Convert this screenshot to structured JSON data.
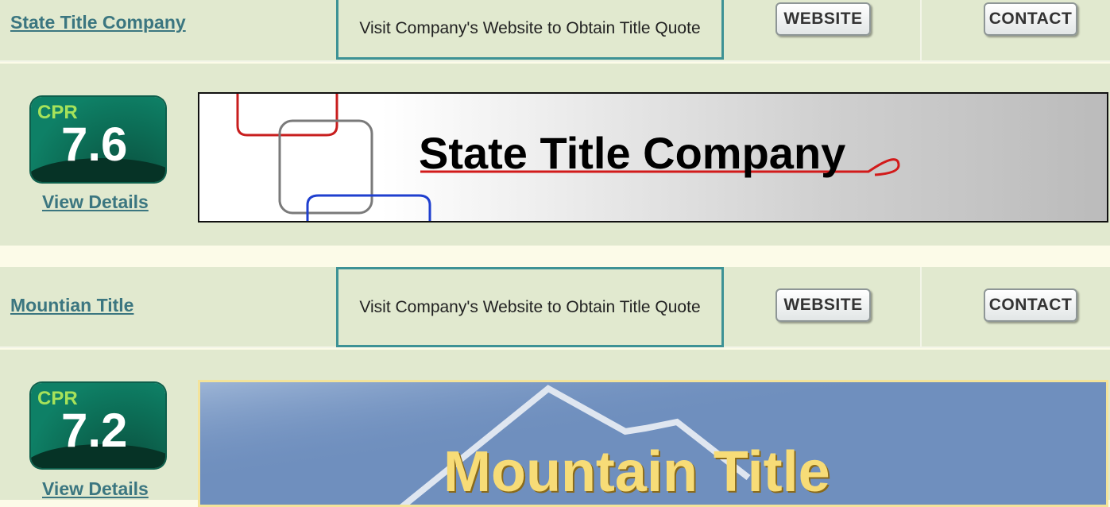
{
  "listings": [
    {
      "company_name": "State Title Company",
      "quote_text": "Visit Company's Website to Obtain Title Quote",
      "website_label": "WEBSITE",
      "contact_label": "CONTACT",
      "cpr_label": "CPR",
      "cpr_score": "7.6",
      "view_details": "View Details",
      "banner_text": "State Title Company"
    },
    {
      "company_name": "Mountian Title",
      "quote_text": "Visit Company's Website to Obtain Title Quote",
      "website_label": "WEBSITE",
      "contact_label": "CONTACT",
      "cpr_label": "CPR",
      "cpr_score": "7.2",
      "view_details": "View Details",
      "banner_text": "Mountain Title"
    }
  ],
  "colors": {
    "row_background": "#e1e9cf",
    "separator": "#fcfbe8",
    "link": "#3b7680",
    "quote_border": "#3d9295",
    "badge_green": "#0e8066",
    "badge_label": "#a6e25a"
  }
}
